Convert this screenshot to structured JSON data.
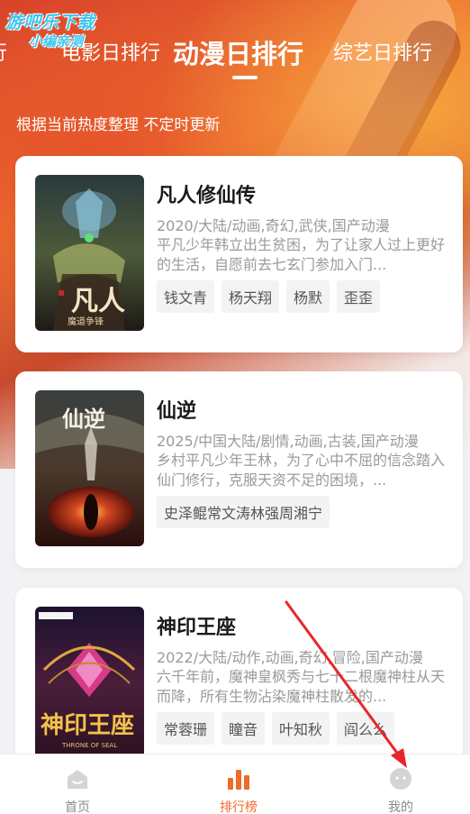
{
  "watermark": {
    "line1": "游吧乐下载",
    "line2": "小编亲测"
  },
  "tabs": [
    {
      "label": "行"
    },
    {
      "label": "电影日排行"
    },
    {
      "label": "动漫日排行"
    },
    {
      "label": "综艺日排行"
    }
  ],
  "subtitle": "根据当前热度整理 不定时更新",
  "cards": [
    {
      "title": "凡人修仙传",
      "meta": "2020/大陆/动画,奇幻,武侠,国产动漫",
      "desc": "平凡少年韩立出生贫困，为了让家人过上更好的生活，自愿前去七玄门参加入门...",
      "tags": [
        "钱文青",
        "杨天翔",
        "杨默",
        "歪歪"
      ],
      "poster_text": "凡人",
      "poster_sub": "魔道争锋"
    },
    {
      "title": "仙逆",
      "meta": "2025/中国大陆/剧情,动画,古装,国产动漫",
      "desc": "乡村平凡少年王林，为了心中不屈的信念踏入仙门修行，克服天资不足的困境，...",
      "tags": [
        "史泽鲲常文涛林强周湘宁"
      ],
      "poster_text": "仙逆"
    },
    {
      "title": "神印王座",
      "meta": "2022/大陆/动作,动画,奇幻,冒险,国产动漫",
      "desc": "六千年前，魔神皇枫秀与七十二根魔神柱从天而降，所有生物沾染魔神柱散发的...",
      "tags": [
        "常蓉珊",
        "瞳音",
        "叶知秋",
        "阎么么"
      ],
      "poster_text": "神印王座",
      "poster_sub": "THRONE OF SEAL"
    }
  ],
  "tabbar": [
    {
      "label": "首页",
      "icon": "home-icon"
    },
    {
      "label": "排行榜",
      "icon": "ranking-icon"
    },
    {
      "label": "我的",
      "icon": "profile-icon"
    }
  ],
  "colors": {
    "accent": "#f06a2a",
    "annotation_arrow": "#e8262a"
  }
}
